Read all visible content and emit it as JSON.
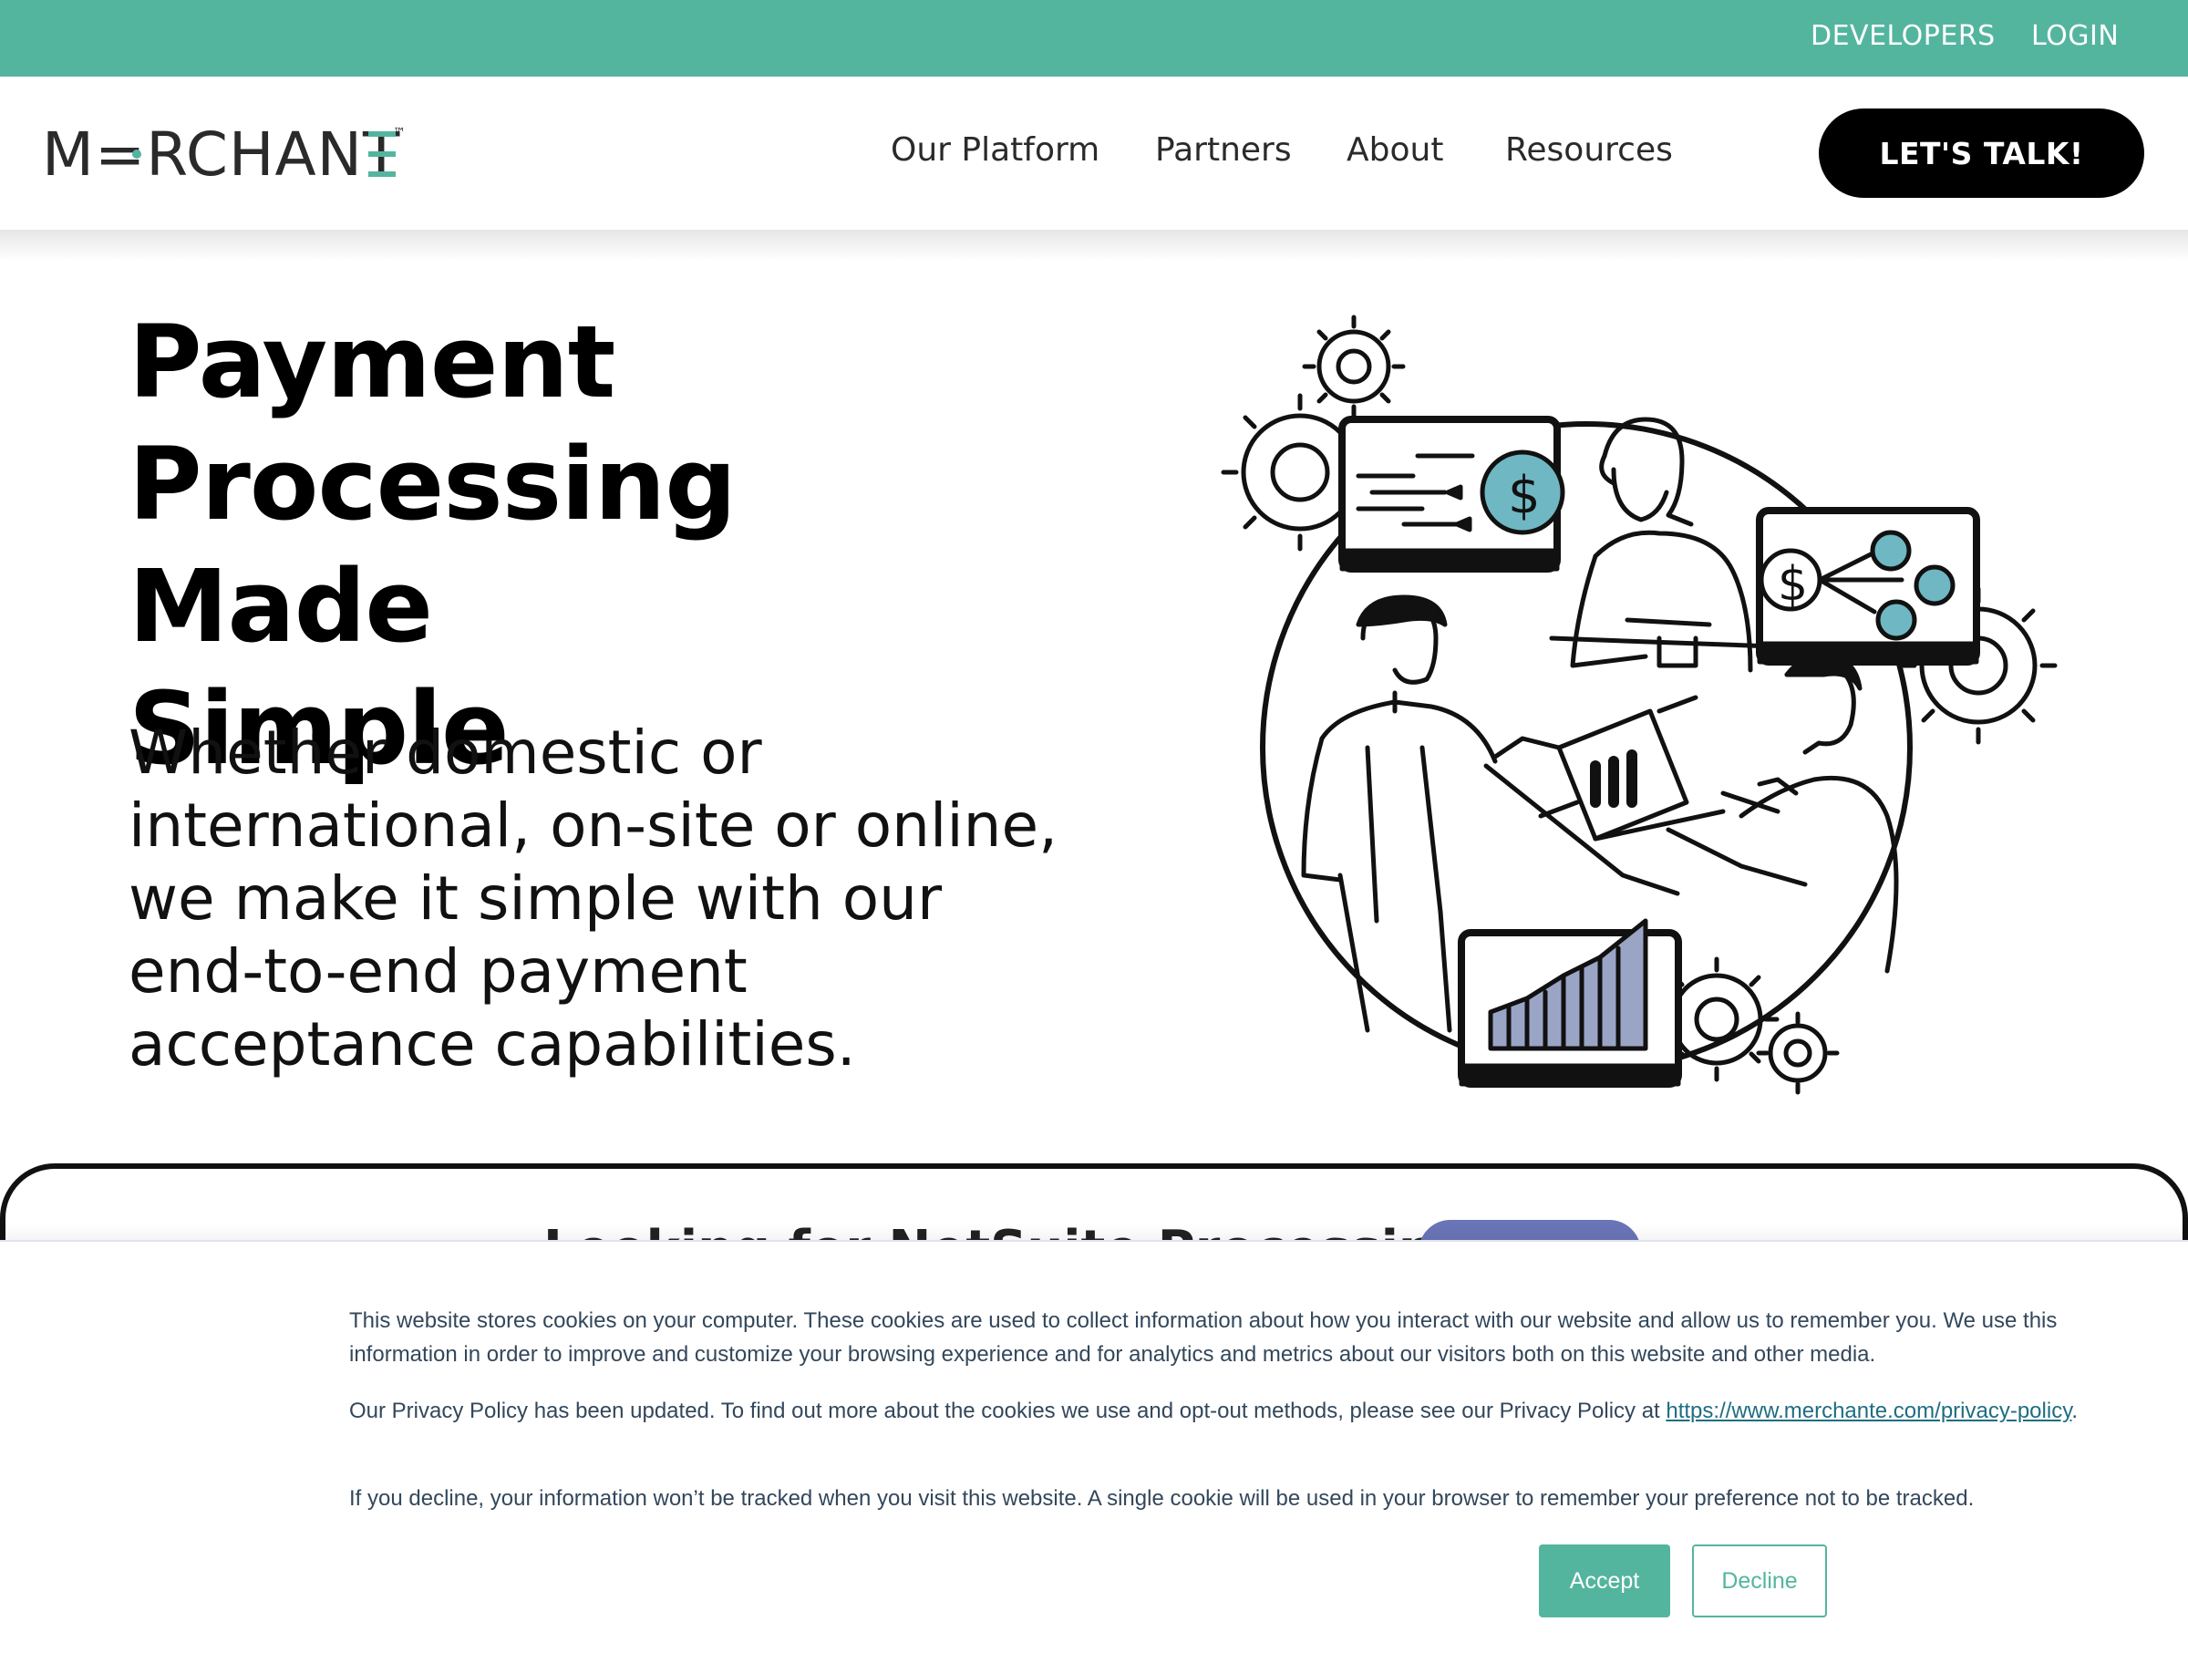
{
  "topbar": {
    "developers": "DEVELOPERS",
    "login": "LOGIN"
  },
  "header": {
    "logo_text": "M=RCHANT=",
    "logo_tm": "™",
    "nav": [
      "Our Platform",
      "Partners",
      "About",
      "Resources"
    ],
    "cta": "LET'S TALK!"
  },
  "hero": {
    "title_lines": [
      "Payment",
      "Processing Made",
      "Simple"
    ],
    "subtitle_lines": [
      "Whether domestic or",
      "international, on-site or online,",
      "we make it simple with our",
      "end-to-end payment",
      "acceptance capabilities."
    ]
  },
  "card": {
    "title_partial": "Looking for NetSuite Processing?"
  },
  "cookie": {
    "p1": "This website stores cookies on your computer. These cookies are used to collect information about how you interact with our website and allow us to remember you. We use this information in order to improve and customize your browsing experience and for analytics and metrics about our visitors both on this website and other media.",
    "p2_text": "Our Privacy Policy has been updated. To find out more about the cookies we use and opt-out methods, please see our Privacy Policy at ",
    "p2_link": "https://www.merchante.com/privacy-policy",
    "p2_end": ".",
    "p3": "If you decline, your information won’t be tracked when you visit this website. A single cookie will be used in your browser to remember your preference not to be tracked.",
    "accept": "Accept",
    "decline": "Decline"
  },
  "colors": {
    "brand_teal": "#54b59f",
    "cta_black": "#000000",
    "cookie_text": "#33475b",
    "illustration_blue": "#6fb7c2",
    "chart_bars": "#9aa5c6"
  },
  "icons": [
    "gear-icon",
    "dollar-icon",
    "user-icon",
    "bar-chart-icon",
    "laptop-icon"
  ]
}
